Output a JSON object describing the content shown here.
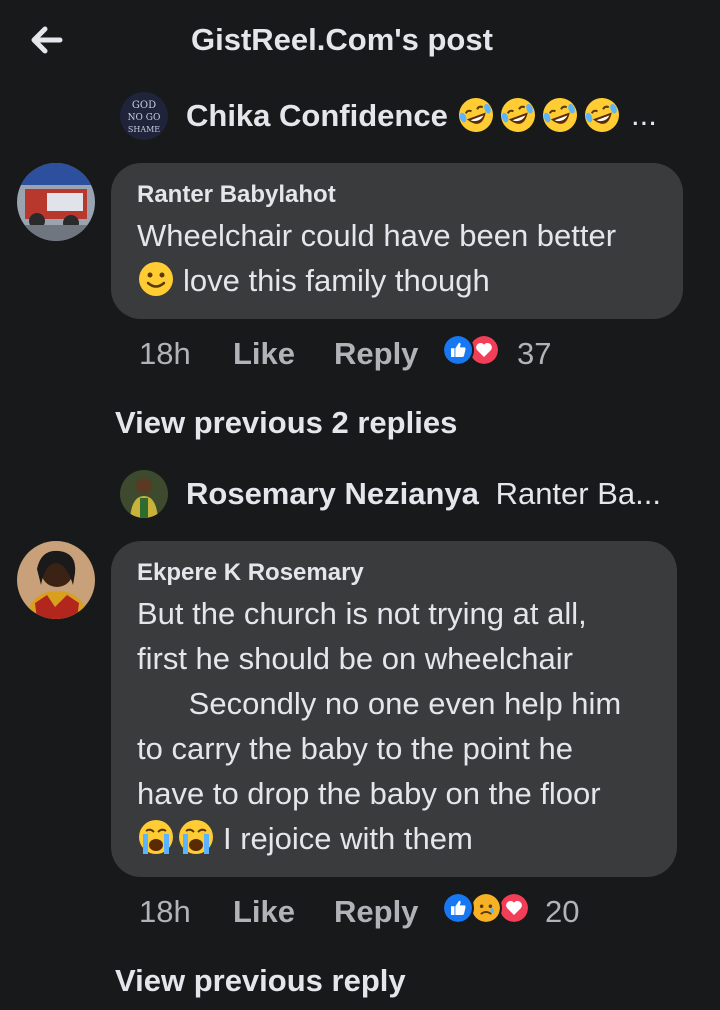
{
  "header": {
    "title": "GistReel.Com's post",
    "back_icon": "arrow-left-icon"
  },
  "reply_preview_1": {
    "name": "Chika Confidence",
    "emojis": [
      "rofl-emoji",
      "rofl-emoji",
      "rofl-emoji",
      "rofl-emoji"
    ],
    "ellipsis": "..."
  },
  "comment_1": {
    "author": "Ranter Babylahot",
    "line1": "Wheelchair could have been better",
    "line2": "love this family though",
    "time": "18h",
    "like": "Like",
    "reply": "Reply",
    "reactions": [
      "like-reaction",
      "love-reaction"
    ],
    "reaction_count": "37"
  },
  "view_prev_1": "View previous 2 replies",
  "reply_preview_2": {
    "name": "Rosemary Nezianya",
    "text": "Ranter Ba..."
  },
  "comment_2": {
    "author": "Ekpere K Rosemary",
    "lines": [
      "But the church is not trying at all,",
      "first he should be on wheelchair",
      "      Secondly no one even help him",
      "to carry the baby to the point he",
      "have to drop the baby on the floor",
      "I rejoice with them"
    ],
    "time": "18h",
    "like": "Like",
    "reply": "Reply",
    "reactions": [
      "like-reaction",
      "sad-reaction",
      "love-reaction"
    ],
    "reaction_count": "20"
  },
  "view_prev_2": "View previous reply",
  "colors": {
    "background": "#18191a",
    "bubble": "#3a3b3c",
    "text": "#e4e6eb",
    "muted": "#b0b3b8",
    "like_blue": "#1877f2",
    "love_red": "#f33e58"
  }
}
